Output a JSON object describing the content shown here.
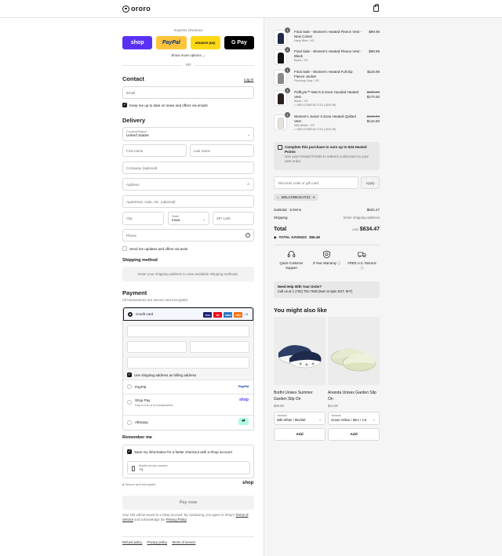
{
  "header": {
    "brand": "ororo"
  },
  "express": {
    "label": "Express checkout",
    "buttons": [
      {
        "label": "shop"
      },
      {
        "label": "PayPal"
      },
      {
        "label": "amazon pay"
      },
      {
        "label": "G Pay"
      }
    ],
    "show_more": "Show more options",
    "or": "OR"
  },
  "contact": {
    "title": "Contact",
    "login": "Log in",
    "email_placeholder": "Email",
    "newsletter": "Keep me up to date on news and offers via emails"
  },
  "delivery": {
    "title": "Delivery",
    "country_label": "Country/Region",
    "country_value": "United States",
    "first_name": "First name",
    "last_name": "Last name",
    "company": "Company (optional)",
    "address": "Address",
    "apartment": "Apartment, suite, etc. (optional)",
    "city": "City",
    "state_label": "State",
    "state_value": "Iowa",
    "zip": "ZIP code",
    "phone": "Phone",
    "sms": "Send me updates and offers via texts"
  },
  "shipping": {
    "title": "Shipping method",
    "notice": "Enter your shipping address to view available shipping methods."
  },
  "payment": {
    "title": "Payment",
    "subtitle": "All transactions are secure and encrypted.",
    "credit_card": "Credit card",
    "cards": [
      {
        "label": "VISA",
        "color": "#1a1f71"
      },
      {
        "label": "MC",
        "color": "#eb001b"
      },
      {
        "label": "AMEX",
        "color": "#2e77bc"
      },
      {
        "label": "DISC",
        "color": "#f47216"
      }
    ],
    "more_cards": "+4",
    "billing_same": "Use shipping address as billing address",
    "paypal": "PayPal",
    "paypal_brand": "PayPal",
    "shoppay": "Shop Pay",
    "shoppay_sub": "Pay in full or in installments",
    "shoppay_brand": "shop",
    "afterpay": "Afterpay"
  },
  "remember": {
    "title": "Remember me",
    "save": "Save my information for a faster checkout with a Shop account",
    "mobile_label": "Mobile phone number",
    "mobile_value": "+1",
    "secure": "Secure and encrypted",
    "shop": "shop"
  },
  "paynow": "Pay now",
  "fine_print": {
    "text1": "Your info will be saved to a Shop account. By continuing, you agree to Shop's",
    "terms": "Terms of Service",
    "text2": "and acknowledge the",
    "privacy": "Privacy Policy",
    "end": "."
  },
  "footer": {
    "links": [
      "Refund policy",
      "Privacy policy",
      "Terms of service"
    ]
  },
  "cart": {
    "items": [
      {
        "qty": "1",
        "name": "Final Sale - Women's Heated Fleece Vest - New Colors",
        "variant": "Navy Blue / XS",
        "price": "$99.99",
        "color": "#1f2a44"
      },
      {
        "qty": "1",
        "name": "Final Sale - Women's Heated Fleece Vest - Black",
        "variant": "Black / XS",
        "price": "$99.99",
        "color": "#111111"
      },
      {
        "qty": "1",
        "name": "Final Sale - Women's Heated Full-Zip Fleece Jacket",
        "variant": "Flecking Gray / XS",
        "price": "$119.99",
        "color": "#8a8a8a"
      },
      {
        "qty": "1",
        "name": "PuffLyte™ Men's 5-Zone Hooded Heated Vest",
        "variant": "Black / XS",
        "discount": "WELCOME15-0724 (-$29.99)",
        "old_price": "$199.99",
        "price": "$170.00",
        "color": "#2a1f1a"
      },
      {
        "qty": "1",
        "name": "Women's Junior 4-Zone Heated Quilted Vest",
        "variant": "Milk White / XS",
        "discount": "WELCOME15-0724 (-$25.49)",
        "old_price": "$169.99",
        "price": "$144.50",
        "color": "#e7e3dc"
      }
    ],
    "earn": {
      "bold": "Complete this purchase to earn up to 634 Heated Points",
      "text": "Use your Heated Points to redeem a discount on your next order."
    },
    "discount_placeholder": "Discount code or gift card",
    "apply": "Apply",
    "applied_code": "WELCOME15-0724",
    "subtotal_label": "Subtotal · 5 items",
    "subtotal_value": "$634.47",
    "shipping_label": "Shipping",
    "shipping_value": "Enter shipping address",
    "total_label": "Total",
    "currency": "USD",
    "total_value": "$634.47",
    "savings_label": "TOTAL SAVINGS",
    "savings_value": "$55.48"
  },
  "features": [
    {
      "label": "Quick Customer Support",
      "icon": "headset-icon"
    },
    {
      "label": "3-Year Warranty",
      "icon": "shield-icon"
    },
    {
      "label": "FREE U.S. Returns",
      "icon": "truck-icon"
    }
  ],
  "help": {
    "title": "Need Help With Your Order?",
    "text": "Call us at 1 (702) 751-7639 (9am to 6pm EST, M-F)"
  },
  "upsell": {
    "title": "You might also like",
    "products": [
      {
        "name": "Bodhi Unisex Summer Garden Slip On",
        "price": "$29.99",
        "variant_label": "Variants",
        "variant_value": "Milk White / Mix/Wit",
        "add": "Add"
      },
      {
        "name": "Ananda Unisex Garden Slip On",
        "price": "$24.99",
        "variant_label": "Variants",
        "variant_value": "Grass Yellow / Men / 4.5",
        "add": "Add"
      }
    ]
  }
}
